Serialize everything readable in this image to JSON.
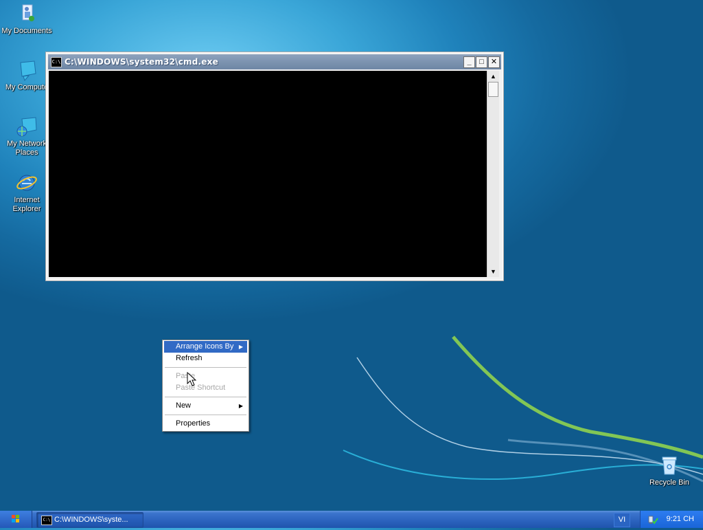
{
  "desktop": {
    "icons": [
      {
        "label": "My Documents",
        "icon": "my-documents-icon"
      },
      {
        "label": "My Compute",
        "icon": "my-computer-icon"
      },
      {
        "label": "My Network Places",
        "icon": "network-places-icon"
      },
      {
        "label": "Internet Explorer",
        "icon": "internet-explorer-icon"
      },
      {
        "label": "Recycle Bin",
        "icon": "recycle-bin-icon"
      }
    ]
  },
  "window": {
    "title": "C:\\WINDOWS\\system32\\cmd.exe",
    "app_icon_text": "C:\\",
    "minimize_label": "_",
    "maximize_label": "□",
    "close_label": "✕",
    "scroll_up": "▲",
    "scroll_down": "▼"
  },
  "context_menu": {
    "items": [
      {
        "label": "Arrange Icons By",
        "submenu": "▶",
        "state": "selected"
      },
      {
        "label": "Refresh",
        "state": "enabled"
      },
      {
        "label": "Paste",
        "state": "disabled"
      },
      {
        "label": "Paste Shortcut",
        "state": "disabled"
      },
      {
        "label": "New",
        "submenu": "▶",
        "state": "enabled"
      },
      {
        "label": "Properties",
        "state": "enabled"
      }
    ]
  },
  "taskbar": {
    "task_label": "C:\\WINDOWS\\syste...",
    "task_icon_text": "C:\\",
    "language": "VI",
    "clock": "9:21 CH"
  },
  "colors": {
    "menu_highlight": "#316ac5",
    "console_bg": "#000000",
    "taskbar": "#2b62bd"
  }
}
